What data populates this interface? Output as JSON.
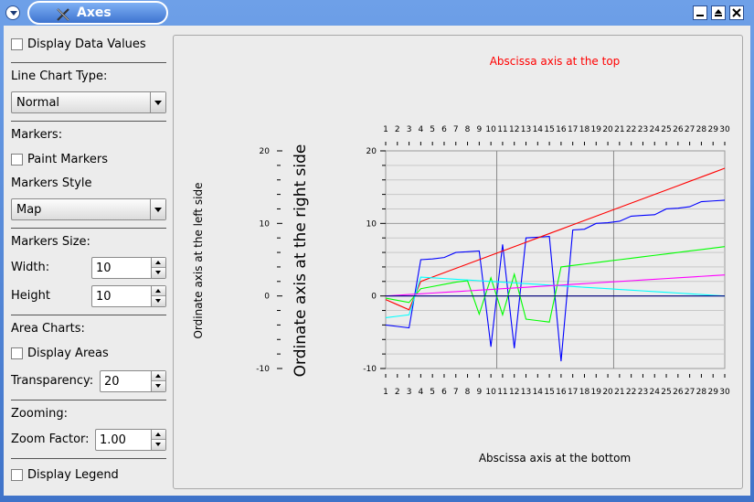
{
  "window": {
    "title": "Axes",
    "colors": {
      "titlebar": "#3f73c9",
      "panel": "#ececec"
    },
    "icons": [
      "menu-icon",
      "app-icon",
      "minimize-icon",
      "maximize-icon",
      "close-icon"
    ]
  },
  "sidebar": {
    "display_data_values": "Display Data Values",
    "line_chart_type_label": "Line Chart Type:",
    "line_chart_type_value": "Normal",
    "markers_label": "Markers:",
    "paint_markers": "Paint Markers",
    "markers_style_label": "Markers Style",
    "markers_style_value": "Map",
    "markers_size_label": "Markers Size:",
    "width_label": "Width:",
    "width_value": "10",
    "height_label": "Height",
    "height_value": "10",
    "area_charts_label": "Area Charts:",
    "display_areas": "Display Areas",
    "transparency_label": "Transparency:",
    "transparency_value": "20",
    "zooming_label": "Zooming:",
    "zoom_factor_label": "Zoom Factor:",
    "zoom_factor_value": "1.00",
    "display_legend": "Display Legend"
  },
  "chart_data": {
    "type": "line",
    "title_top": "Abscissa axis at the top",
    "title_top_color": "#ff0000",
    "xlabel": "Abscissa axis at the bottom",
    "ylabel_left": "Ordinate axis at the left side",
    "ylabel_right": "Ordinate axis at the right side",
    "x": [
      1,
      2,
      3,
      4,
      5,
      6,
      7,
      8,
      9,
      10,
      11,
      12,
      13,
      14,
      15,
      16,
      17,
      18,
      19,
      20,
      21,
      22,
      23,
      24,
      25,
      26,
      27,
      28,
      29,
      30
    ],
    "ylim": [
      -10,
      20
    ],
    "y_ticks": [
      -10,
      0,
      10,
      20
    ],
    "grid": true,
    "series": [
      {
        "color": "#0000ff",
        "values": [
          -4,
          -4.2,
          -4.4,
          5,
          5.1,
          5.3,
          6,
          6.1,
          6.2,
          -7,
          7.1,
          -7.2,
          8,
          8.1,
          8.2,
          -9,
          9.1,
          9.2,
          10,
          10.1,
          10.3,
          11,
          11.1,
          11.2,
          12,
          12.1,
          12.3,
          13,
          13.1,
          13.2
        ]
      },
      {
        "color": "#ff0000",
        "values": [
          -0.5,
          -1.2,
          -1.9,
          2,
          2.6,
          3.2,
          3.8,
          4.4,
          5,
          5.6,
          6.2,
          6.8,
          7.4,
          8,
          8.6,
          9.2,
          9.8,
          10.4,
          11,
          11.6,
          12.2,
          12.8,
          13.4,
          14,
          14.6,
          15.2,
          15.8,
          16.4,
          17,
          17.6
        ]
      },
      {
        "color": "#00ff00",
        "values": [
          -0.3,
          -0.6,
          -0.9,
          1,
          1.3,
          1.6,
          1.9,
          2.1,
          -2.5,
          2.5,
          -2.6,
          3,
          -3.2,
          -3.4,
          -3.6,
          4,
          4.2,
          4.4,
          4.6,
          4.8,
          5,
          5.2,
          5.4,
          5.6,
          5.8,
          6,
          6.2,
          6.4,
          6.6,
          6.8
        ]
      },
      {
        "color": "#00ffff",
        "values": [
          -3,
          -2.8,
          -2.6,
          2.6,
          2.5,
          2.4,
          2.3,
          2.2,
          2.1,
          2,
          1.9,
          1.8,
          1.7,
          1.6,
          1.5,
          1.4,
          1.3,
          1.2,
          1.1,
          1,
          0.9,
          0.8,
          0.7,
          0.6,
          0.5,
          0.4,
          0.3,
          0.2,
          0.1,
          0
        ]
      },
      {
        "color": "#ff00ff",
        "values": [
          0,
          0.1,
          0.2,
          0.3,
          0.4,
          0.5,
          0.6,
          0.7,
          0.8,
          0.9,
          1,
          1.1,
          1.2,
          1.3,
          1.4,
          1.5,
          1.6,
          1.7,
          1.8,
          1.9,
          2,
          2.1,
          2.2,
          2.3,
          2.4,
          2.5,
          2.6,
          2.7,
          2.8,
          2.9
        ]
      },
      {
        "color": "#000080",
        "values": [
          0,
          0,
          0,
          0,
          0,
          0,
          0,
          0,
          0,
          0,
          0,
          0,
          0,
          0,
          0,
          0,
          0,
          0,
          0,
          0,
          0,
          0,
          0,
          0,
          0,
          0,
          0,
          0,
          0,
          0
        ]
      }
    ]
  }
}
